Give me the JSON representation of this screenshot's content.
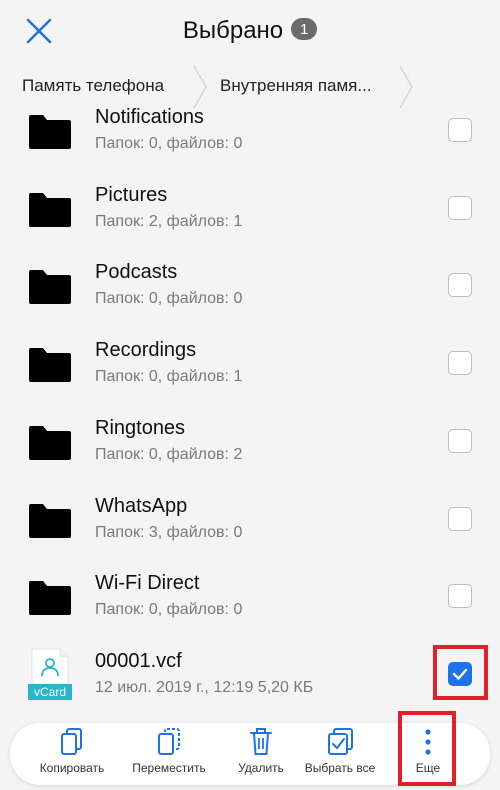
{
  "header": {
    "title": "Выбрано",
    "count": "1"
  },
  "breadcrumb": {
    "items": [
      "Память телефона",
      "Внутренняя памя..."
    ]
  },
  "files": [
    {
      "name": "Notifications",
      "meta": "Папок: 0, файлов: 0",
      "type": "folder",
      "checked": false
    },
    {
      "name": "Pictures",
      "meta": "Папок: 2, файлов: 1",
      "type": "folder",
      "checked": false
    },
    {
      "name": "Podcasts",
      "meta": "Папок: 0, файлов: 0",
      "type": "folder",
      "checked": false
    },
    {
      "name": "Recordings",
      "meta": "Папок: 0, файлов: 1",
      "type": "folder",
      "checked": false
    },
    {
      "name": "Ringtones",
      "meta": "Папок: 0, файлов: 2",
      "type": "folder",
      "checked": false
    },
    {
      "name": "WhatsApp",
      "meta": "Папок: 3, файлов: 0",
      "type": "folder",
      "checked": false
    },
    {
      "name": "Wi-Fi Direct",
      "meta": "Папок: 0, файлов: 0",
      "type": "folder",
      "checked": false
    },
    {
      "name": "00001.vcf",
      "meta": "12 июл. 2019 г., 12:19 5,20 КБ",
      "type": "vcard",
      "checked": true,
      "icon_label": "vCard"
    }
  ],
  "toolbar": {
    "copy": "Копировать",
    "move": "Переместить",
    "delete": "Удалить",
    "select_all": "Выбрать все",
    "more": "Еще"
  },
  "colors": {
    "accent": "#1e73e8",
    "highlight": "#e0202a",
    "background": "#f4f4f4",
    "vcard": "#29b6c9"
  }
}
